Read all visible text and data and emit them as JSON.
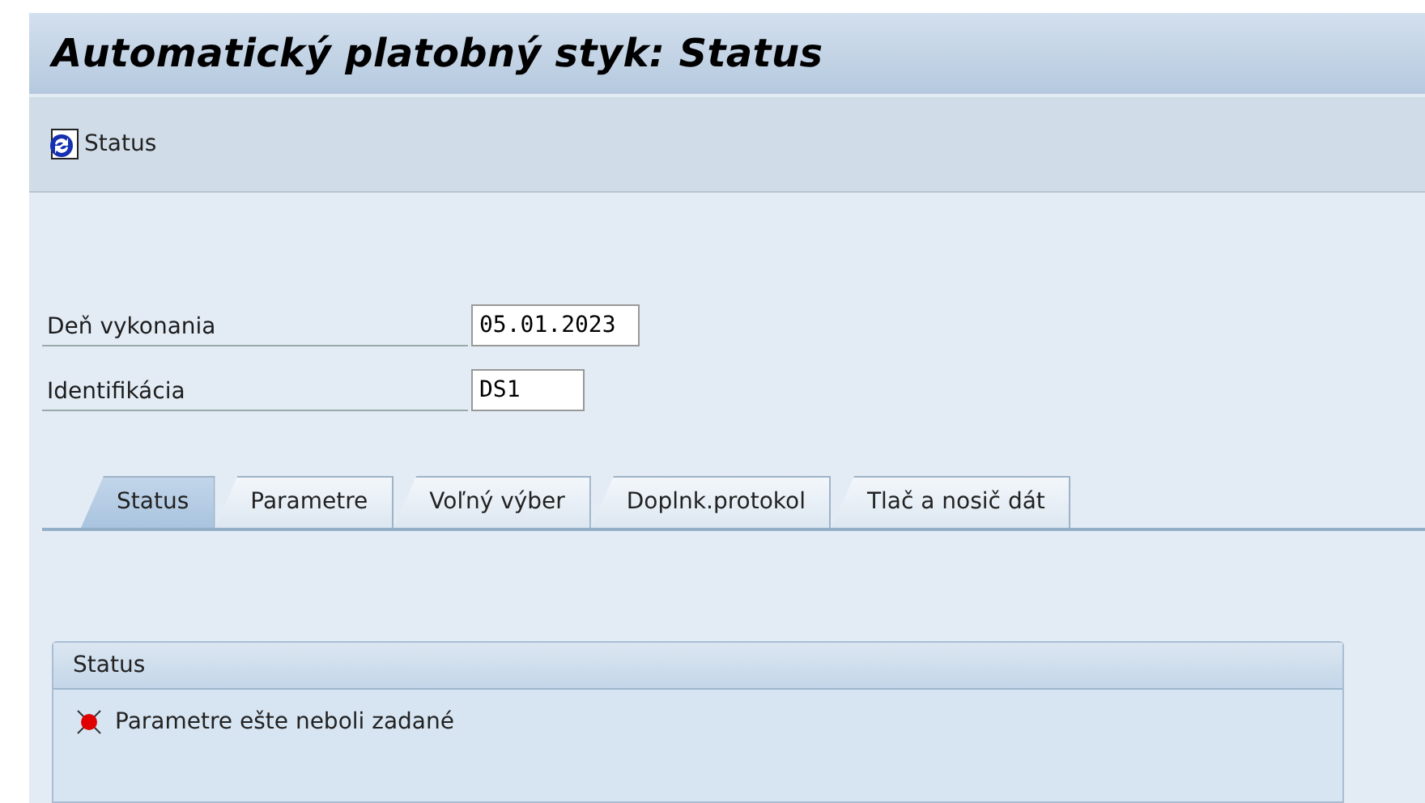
{
  "window": {
    "title": "Automatický platobný styk: Status"
  },
  "toolbar": {
    "buttons": [
      {
        "label": "Status"
      }
    ]
  },
  "fields": [
    {
      "label": "Deň vykonania",
      "value": "05.01.2023"
    },
    {
      "label": "Identifikácia",
      "value": "DS1"
    }
  ],
  "tabs": [
    {
      "label": "Status",
      "selected": true
    },
    {
      "label": "Parametre",
      "selected": false
    },
    {
      "label": "Voľný výber",
      "selected": false
    },
    {
      "label": "Doplnk.protokol",
      "selected": false
    },
    {
      "label": "Tlač a nosič dát",
      "selected": false
    }
  ],
  "status_group": {
    "title": "Status",
    "messages": [
      {
        "color": "#e00000",
        "text": "Parametre ešte neboli zadané"
      }
    ]
  }
}
